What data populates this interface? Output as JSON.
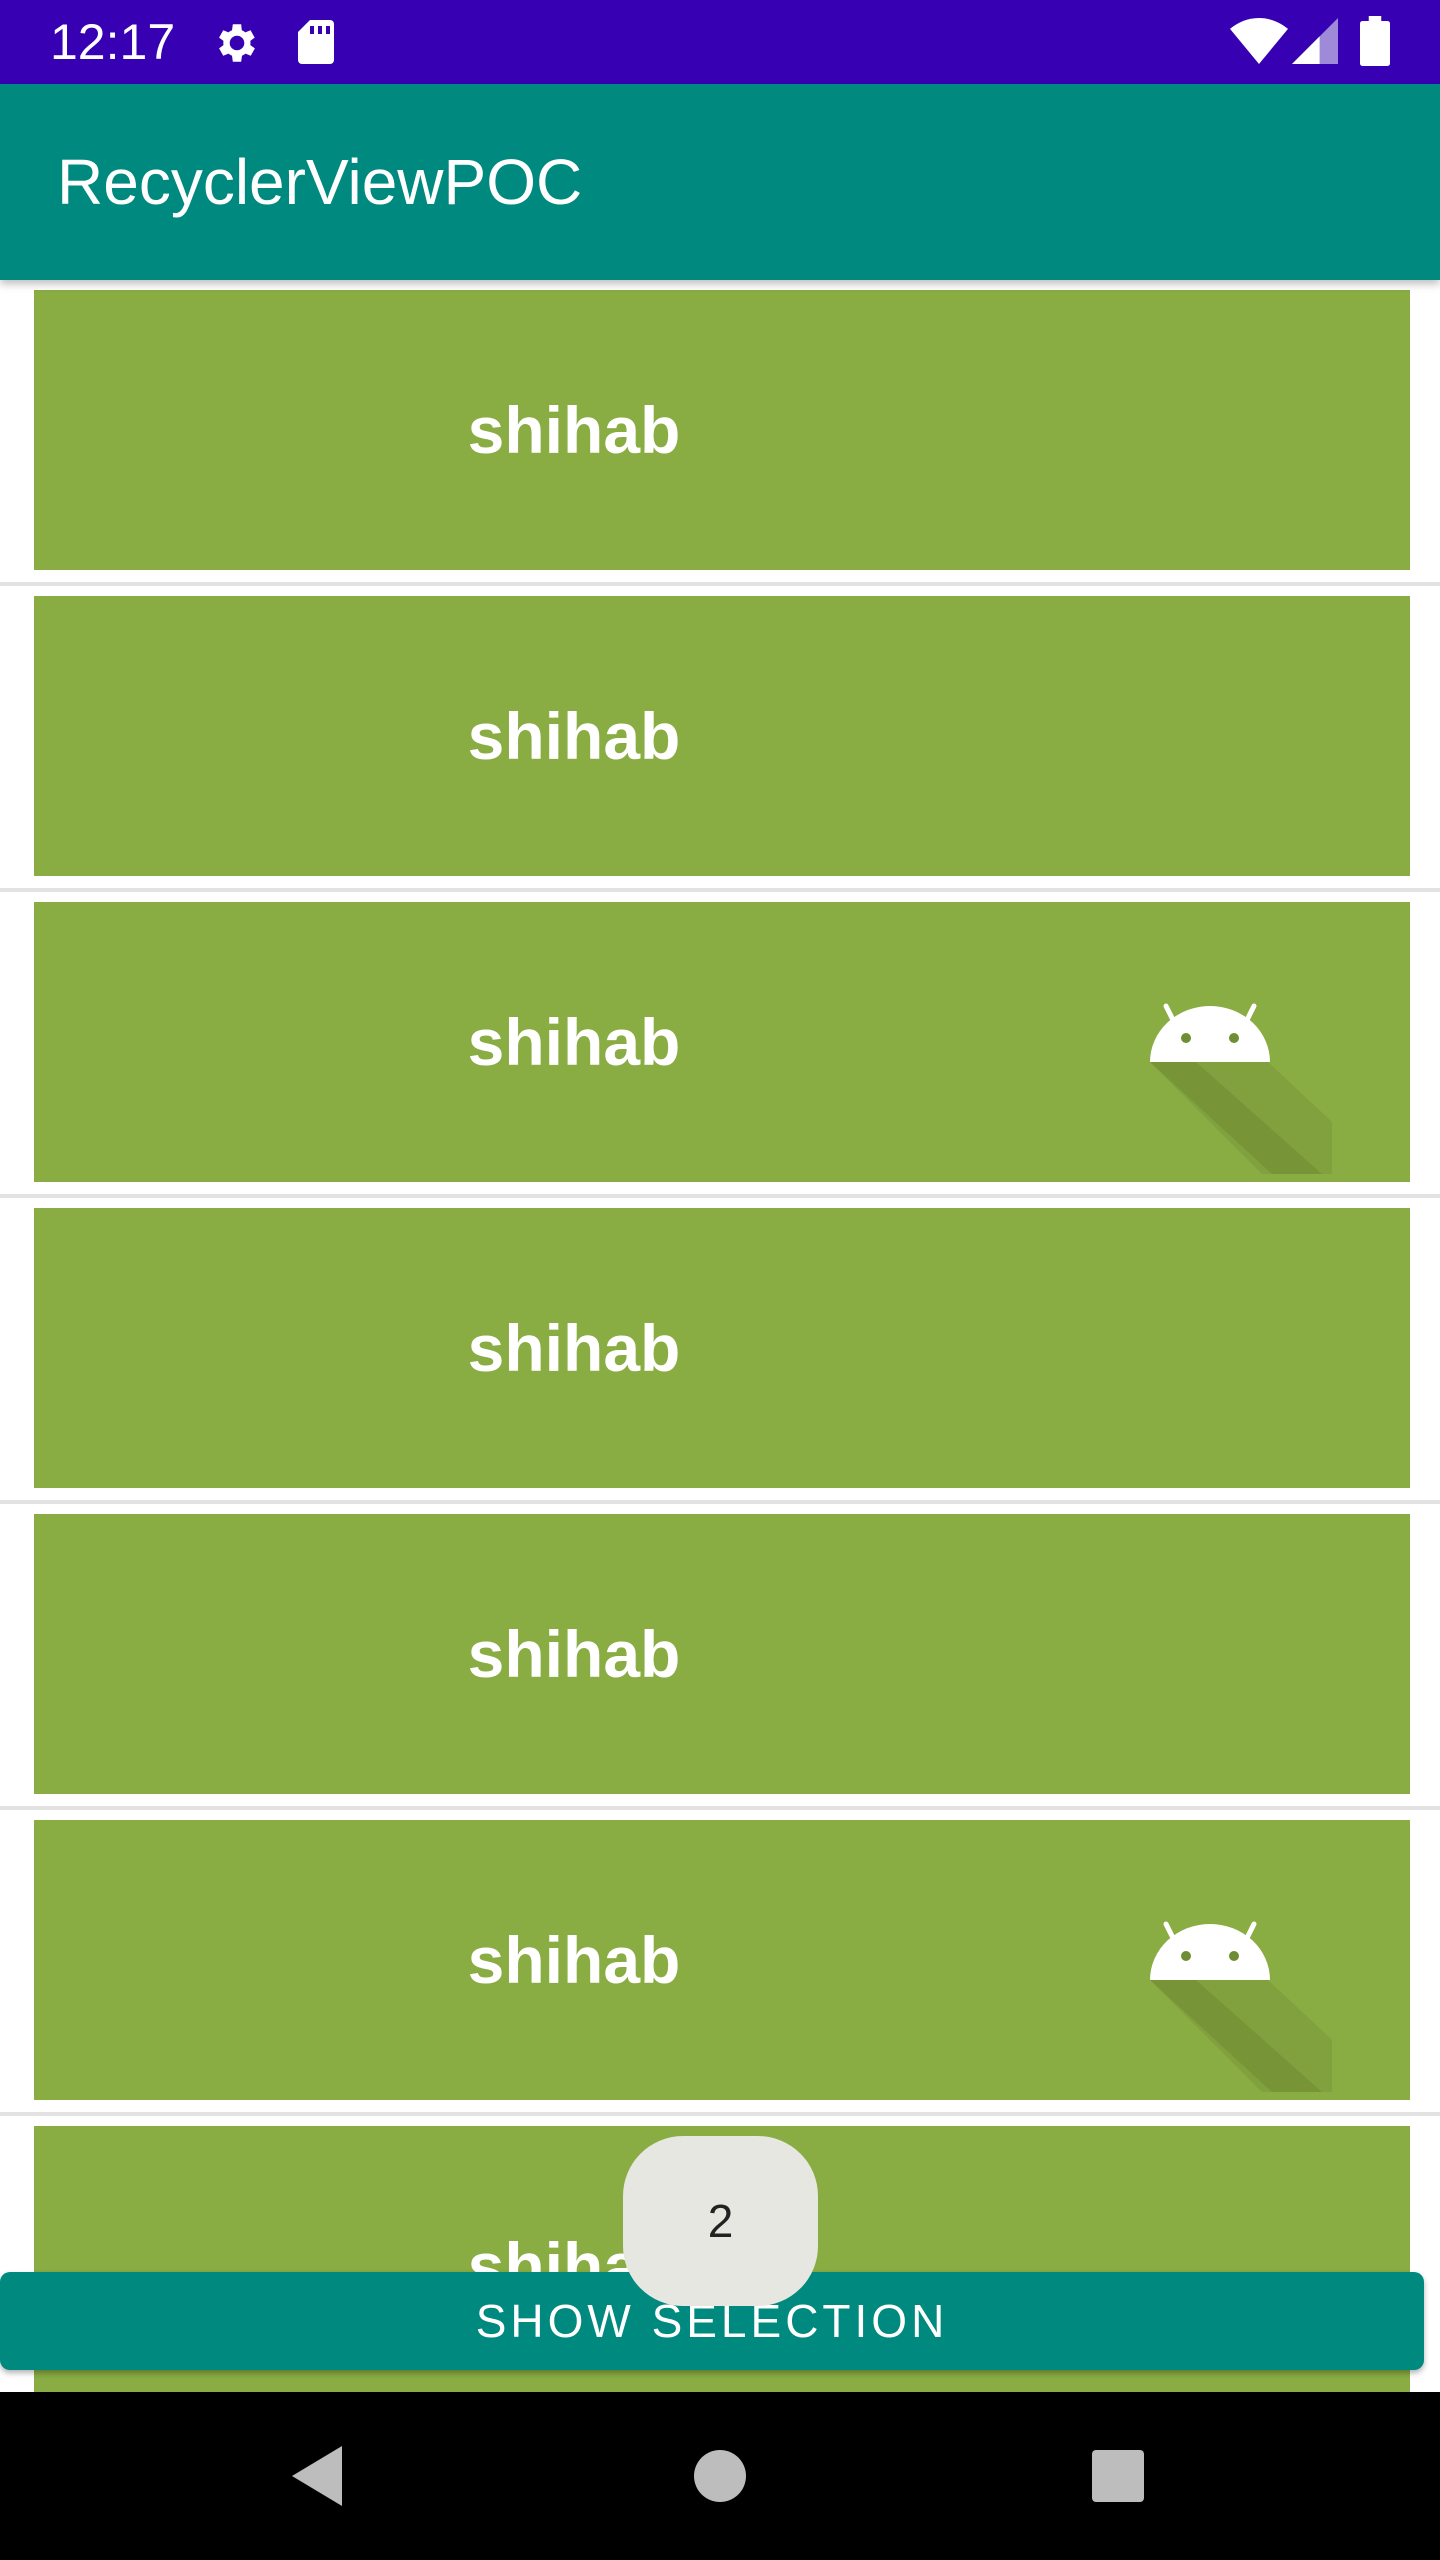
{
  "status_bar": {
    "time": "12:17",
    "icons": [
      "gear-icon",
      "sd-card-icon",
      "wifi-icon",
      "signal-icon",
      "battery-icon"
    ]
  },
  "app_bar": {
    "title": "RecyclerViewPOC"
  },
  "list": {
    "items": [
      {
        "label": "shihab",
        "selected": false
      },
      {
        "label": "shihab",
        "selected": false
      },
      {
        "label": "shihab",
        "selected": true
      },
      {
        "label": "shihab",
        "selected": false
      },
      {
        "label": "shihab",
        "selected": false
      },
      {
        "label": "shihab",
        "selected": true
      },
      {
        "label": "shihab",
        "selected": false
      }
    ]
  },
  "selection": {
    "count": "2"
  },
  "bottom_button": {
    "label": "SHOW SELECTION"
  },
  "nav_bar": {
    "buttons": [
      "back-icon",
      "home-icon",
      "recents-icon"
    ]
  },
  "colors": {
    "status_bar": "#3700b3",
    "app_bar": "#00897f",
    "card": "#89ac43",
    "button": "#00897f",
    "chip": "#e5e7e0"
  }
}
